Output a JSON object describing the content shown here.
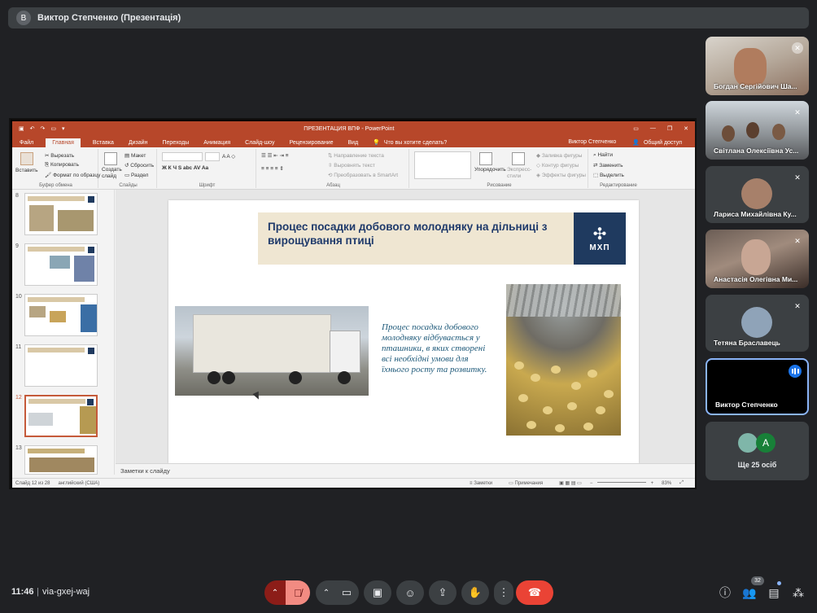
{
  "meeting": {
    "presenter_banner": "Виктор Степченко (Презентація)",
    "presenter_initial": "B",
    "time": "11:46",
    "separator": "|",
    "code": "via-gxej-waj",
    "participant_count": "32"
  },
  "ppt": {
    "window_title": "ПРЕЗЕНТАЦИЯ ВПФ - PowerPoint",
    "user_name": "Виктор Степченко",
    "share_label": "Общий доступ",
    "tabs": [
      "Файл",
      "Главная",
      "Вставка",
      "Дизайн",
      "Переходы",
      "Анимация",
      "Слайд-шоу",
      "Рецензирование",
      "Вид"
    ],
    "active_tab": "Главная",
    "tell_me": "Что вы хотите сделать?",
    "ribbon": {
      "paste": "Вставить",
      "cut": "Вырезать",
      "copy": "Копировать",
      "format_painter": "Формат по образцу",
      "clipboard_group": "Буфер обмена",
      "new_slide": "Создать слайд",
      "layout": "Макет",
      "reset": "Сбросить",
      "section": "Раздел",
      "slides_group": "Слайды",
      "font_group": "Шрифт",
      "text_direction": "Направление текста",
      "align_text": "Выровнять текст",
      "smartart": "Преобразовать в SmartArt",
      "paragraph_group": "Абзац",
      "arrange": "Упорядочить",
      "quick_styles": "Экспресс-стили",
      "shape_fill": "Заливка фигуры",
      "shape_outline": "Контур фигуры",
      "shape_effects": "Эффекты фигуры",
      "drawing_group": "Рисование",
      "find": "Найти",
      "replace": "Заменить",
      "select": "Выделить",
      "editing_group": "Редактирование"
    },
    "thumb_numbers": [
      "8",
      "9",
      "10",
      "11",
      "12",
      "13"
    ],
    "slide": {
      "title": "Процес посадки добового молодняку на дільниці з вирощування птиці",
      "logo_text": "МХП",
      "body": "Процес посадки добового молодняку відбувається у пташники, в яких створені всі необхідні умови для їхнього росту та розвитку."
    },
    "notes_placeholder": "Заметки к слайду",
    "status": {
      "slide_of": "Слайд 12 из 28",
      "language": "английский (США)",
      "notes": "Заметки",
      "comments": "Примечания",
      "zoom": "83%"
    }
  },
  "participants": [
    {
      "name": "Богдан Сергійович Ша...",
      "muted": true
    },
    {
      "name": "Світлана Олексіївна Ус...",
      "muted": true
    },
    {
      "name": "Лариса Михайлівна Ку...",
      "muted": true
    },
    {
      "name": "Анастасія Олегівна Ми...",
      "muted": true
    },
    {
      "name": "Тетяна Браславець",
      "muted": true
    },
    {
      "name": "Виктор Степченко",
      "speaking": true
    }
  ],
  "more_participants": {
    "label": "Ще 25 осіб",
    "initial": "A"
  },
  "colors": {
    "ppt_accent": "#b7472a",
    "meet_bg": "#202124",
    "end_call": "#ea4335",
    "speaking_blue": "#1a73e8"
  },
  "icons": [
    "mic-off-icon",
    "camera-icon",
    "captions-icon",
    "emoji-icon",
    "present-icon",
    "raise-hand-icon",
    "more-icon",
    "end-call-icon",
    "info-icon",
    "people-icon",
    "chat-icon",
    "activities-icon"
  ]
}
